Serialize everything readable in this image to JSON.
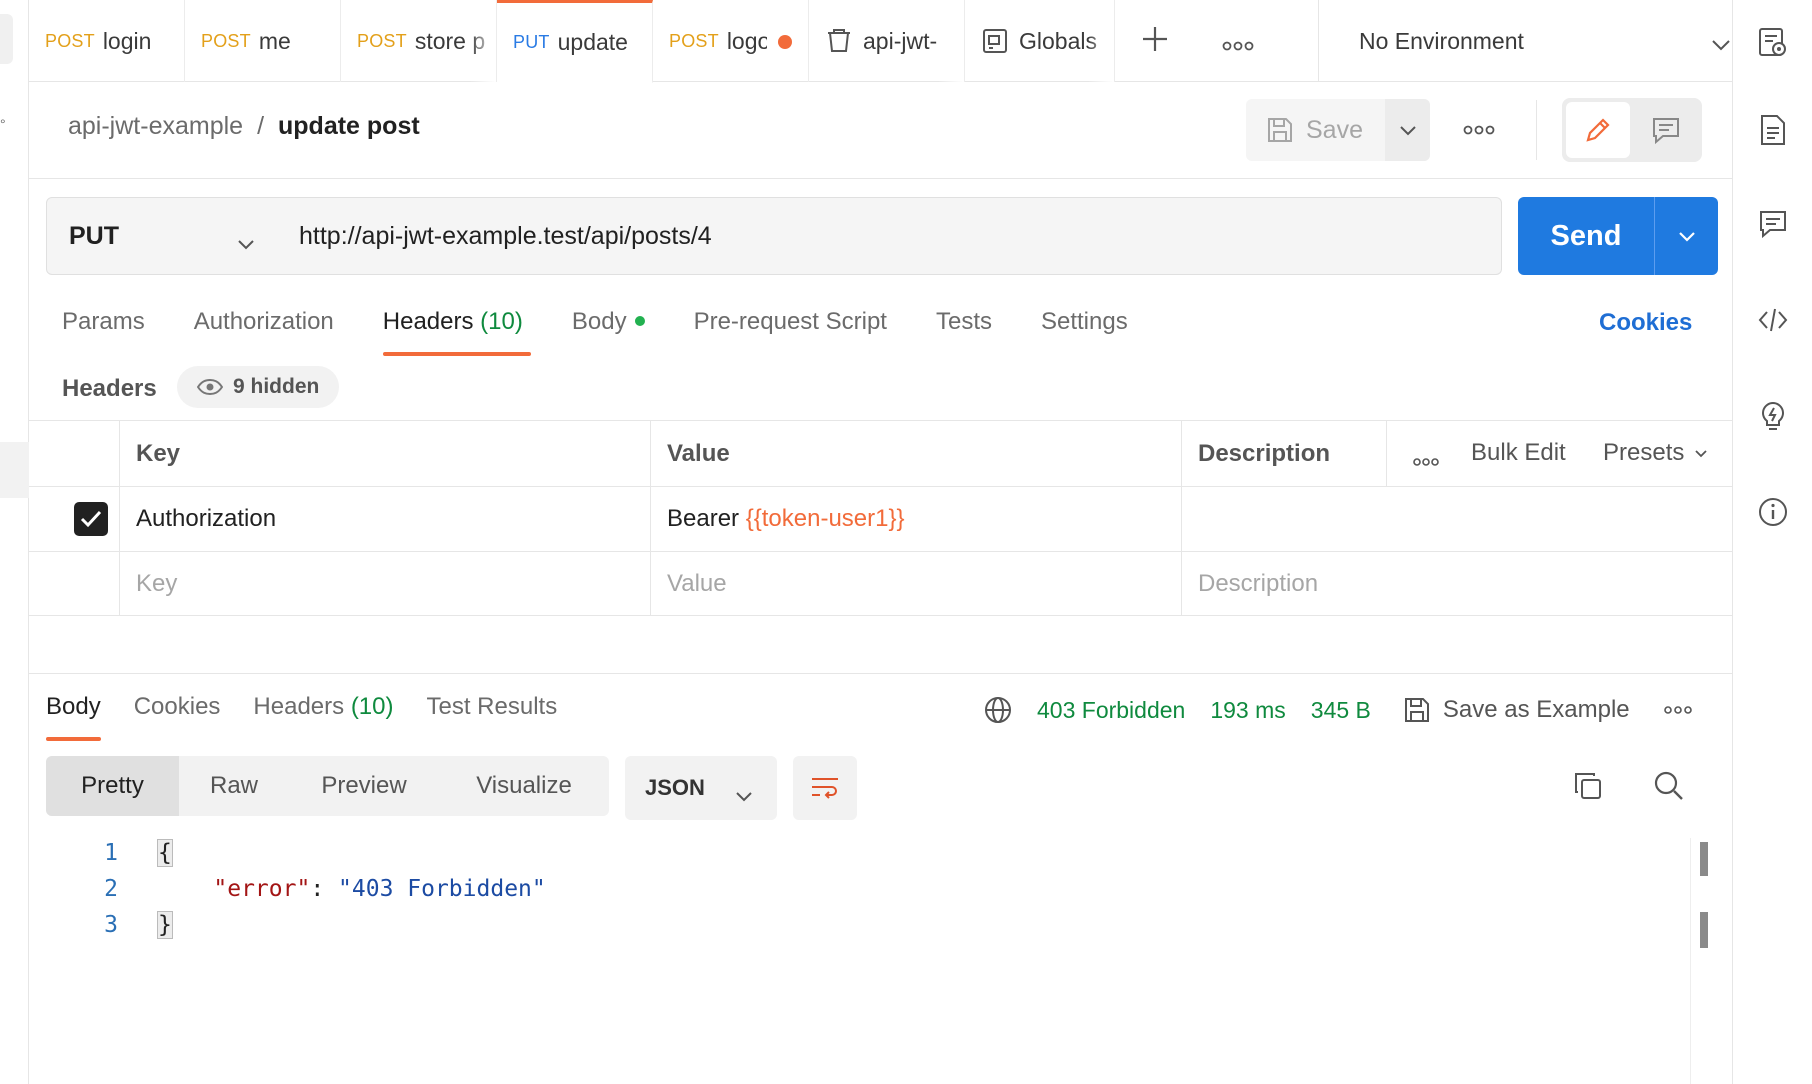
{
  "tabs": [
    {
      "method": "POST",
      "name": "login"
    },
    {
      "method": "POST",
      "name": "me"
    },
    {
      "method": "POST",
      "name": "store p"
    },
    {
      "method": "PUT",
      "name": "update"
    },
    {
      "method": "POST",
      "name": "logout"
    },
    {
      "name": "api-jwt-"
    },
    {
      "name": "Globals"
    }
  ],
  "environment": {
    "selected": "No Environment"
  },
  "breadcrumb": {
    "collection": "api-jwt-example",
    "separator": "/",
    "request": "update post"
  },
  "toolbar": {
    "save_label": "Save"
  },
  "request": {
    "method": "PUT",
    "url": "http://api-jwt-example.test/api/posts/4",
    "send_label": "Send"
  },
  "request_tabs": {
    "params": "Params",
    "authorization": "Authorization",
    "headers": "Headers",
    "headers_count": "(10)",
    "body": "Body",
    "prerequest": "Pre-request Script",
    "tests": "Tests",
    "settings": "Settings",
    "cookies": "Cookies"
  },
  "headers_section": {
    "title": "Headers",
    "hidden": "9 hidden",
    "columns": {
      "key": "Key",
      "value": "Value",
      "description": "Description"
    },
    "bulk_edit": "Bulk Edit",
    "presets": "Presets",
    "row1": {
      "checked": true,
      "key": "Authorization",
      "value_prefix": "Bearer ",
      "value_var": "{{token-user1}}"
    },
    "new_row": {
      "key": "Key",
      "value": "Value",
      "description": "Description"
    }
  },
  "response_tabs": {
    "body": "Body",
    "cookies": "Cookies",
    "headers": "Headers",
    "headers_count": "(10)",
    "test_results": "Test Results"
  },
  "response_meta": {
    "status": "403 Forbidden",
    "time": "193 ms",
    "size": "345 B",
    "save_example": "Save as Example"
  },
  "format": {
    "options": [
      "Pretty",
      "Raw",
      "Preview",
      "Visualize"
    ],
    "language": "JSON"
  },
  "code": {
    "line_numbers": [
      "1",
      "2",
      "3"
    ],
    "open": "{",
    "key": "\"error\"",
    "colon": ": ",
    "value": "\"403 Forbidden\"",
    "close": "}"
  },
  "colors": {
    "accent": "#f26b3a",
    "send": "#1f7ae0",
    "success": "#0f8a3e",
    "post": "#e3a01a",
    "put": "#2a7be4"
  }
}
